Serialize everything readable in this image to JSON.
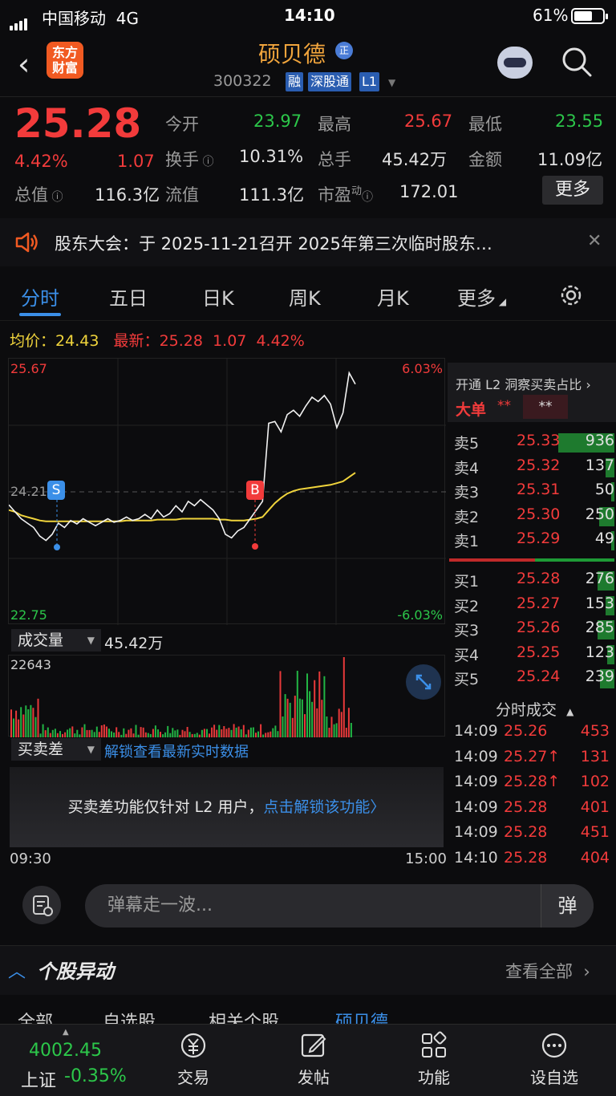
{
  "status_bar": {
    "carrier": "中国移动",
    "network": "4G",
    "time": "14:10",
    "battery": "61%"
  },
  "header": {
    "logo_text": "东方财富",
    "stock_name": "硕贝德",
    "stock_badge": "正",
    "stock_code": "300322",
    "tags": [
      "融",
      "深股通",
      "L1"
    ]
  },
  "quote": {
    "price": "25.28",
    "change_pct": "4.42%",
    "change": "1.07",
    "open_label": "今开",
    "open": "23.97",
    "high_label": "最高",
    "high": "25.67",
    "low_label": "最低",
    "low": "23.55",
    "turnover_label": "换手",
    "turnover": "10.31%",
    "volume_label": "总手",
    "volume": "45.42万",
    "amount_label": "金额",
    "amount": "11.09亿",
    "mktcap_label": "总值",
    "mktcap": "116.3亿",
    "float_label": "流值",
    "float": "111.3亿",
    "pe_label": "市盈",
    "pe_sup": "动",
    "pe": "172.01",
    "more_label": "更多"
  },
  "notice": {
    "text": "股东大会：于 2025-11-21召开 2025年第三次临时股东…"
  },
  "tabs": [
    "分时",
    "五日",
    "日K",
    "周K",
    "月K",
    "更多"
  ],
  "chart_info": {
    "avg_label": "均价：",
    "avg": "24.43",
    "latest_label": "最新：",
    "latest": "25.28",
    "latest_chg": "1.07",
    "latest_pct": "4.42%"
  },
  "chart_labels": {
    "top_price": "25.67",
    "top_pct": "6.03%",
    "mid_price": "24.21",
    "bottom_price": "22.75",
    "bottom_pct": "-6.03%",
    "sell_marker": "S",
    "buy_marker": "B"
  },
  "chart_data": {
    "type": "line",
    "ylim": [
      22.75,
      25.67
    ],
    "reference_price": 24.21,
    "series": [
      {
        "values": [
          24.06,
          23.98,
          23.9,
          23.85,
          23.8,
          23.7,
          23.65,
          23.72,
          23.85,
          23.8,
          23.88,
          23.84,
          23.9,
          23.86,
          23.82,
          23.86,
          23.9,
          23.86,
          23.88,
          23.92,
          23.88,
          23.9,
          23.95,
          23.9,
          24.0,
          23.92,
          23.96,
          24.05,
          23.98,
          24.1,
          24.05,
          24.12,
          24.06,
          24.0,
          23.9,
          23.72,
          23.68,
          23.76,
          23.8,
          23.9,
          24.0,
          24.1,
          25.0,
          25.02,
          24.9,
          25.1,
          25.15,
          25.08,
          25.2,
          25.3,
          25.25,
          25.32,
          25.22,
          24.95,
          25.12,
          25.58,
          25.45
        ]
      },
      {
        "values": [
          24.0,
          23.98,
          23.94,
          23.92,
          23.9,
          23.88,
          23.87,
          23.87,
          23.87,
          23.87,
          23.87,
          23.87,
          23.87,
          23.87,
          23.87,
          23.87,
          23.87,
          23.87,
          23.87,
          23.88,
          23.88,
          23.88,
          23.88,
          23.88,
          23.89,
          23.89,
          23.89,
          23.89,
          23.9,
          23.9,
          23.9,
          23.9,
          23.9,
          23.9,
          23.89,
          23.89,
          23.88,
          23.88,
          23.88,
          23.89,
          23.9,
          23.92,
          24.0,
          24.08,
          24.14,
          24.19,
          24.22,
          24.24,
          24.25,
          24.26,
          24.27,
          24.28,
          24.29,
          24.31,
          24.33,
          24.38,
          24.43
        ]
      }
    ]
  },
  "panel": {
    "header": "开通 L2 洞察买卖占比",
    "big_order_label": "大单",
    "big_order_a": "**",
    "big_order_b": "**",
    "asks": [
      {
        "label": "卖5",
        "price": "25.33",
        "vol": "936",
        "bar": 1.0
      },
      {
        "label": "卖4",
        "price": "25.32",
        "vol": "137",
        "bar": 0.15
      },
      {
        "label": "卖3",
        "price": "25.31",
        "vol": "50",
        "bar": 0.05
      },
      {
        "label": "卖2",
        "price": "25.30",
        "vol": "250",
        "bar": 0.27
      },
      {
        "label": "卖1",
        "price": "25.29",
        "vol": "49",
        "bar": 0.05
      }
    ],
    "bids": [
      {
        "label": "买1",
        "price": "25.28",
        "vol": "276",
        "bar": 0.3
      },
      {
        "label": "买2",
        "price": "25.27",
        "vol": "153",
        "bar": 0.16
      },
      {
        "label": "买3",
        "price": "25.26",
        "vol": "285",
        "bar": 0.3
      },
      {
        "label": "买4",
        "price": "25.25",
        "vol": "123",
        "bar": 0.13
      },
      {
        "label": "买5",
        "price": "25.24",
        "vol": "239",
        "bar": 0.26
      }
    ],
    "ticks_title": "分时成交",
    "ticks": [
      {
        "time": "14:09",
        "price": "25.26",
        "vol": "453"
      },
      {
        "time": "14:09",
        "price": "25.27↑",
        "vol": "131"
      },
      {
        "time": "14:09",
        "price": "25.28↑",
        "vol": "102"
      },
      {
        "time": "14:09",
        "price": "25.28",
        "vol": "401"
      },
      {
        "time": "14:09",
        "price": "25.28",
        "vol": "451"
      },
      {
        "time": "14:10",
        "price": "25.28",
        "vol": "404"
      }
    ]
  },
  "volume": {
    "dropdown": "成交量",
    "total": "45.42万",
    "max": "22643"
  },
  "bsd": {
    "dropdown": "买卖差",
    "unlock_link": "解锁查看最新实时数据",
    "lock_text": "买卖差功能仅针对 L2 用户，",
    "lock_link": "点击解锁该功能〉"
  },
  "time_axis": {
    "start": "09:30",
    "end": "15:00"
  },
  "danmu": {
    "placeholder": "弹幕走一波...",
    "button": "弹"
  },
  "section": {
    "title": "个股异动",
    "view_all": "查看全部"
  },
  "subtabs": [
    "全部",
    "自选股",
    "相关个股",
    "硕贝德"
  ],
  "bottom_nav": {
    "index_value": "4002.45",
    "index_name": "上证",
    "index_change": "-0.35%",
    "items": [
      "交易",
      "发帖",
      "功能",
      "设自选"
    ]
  }
}
